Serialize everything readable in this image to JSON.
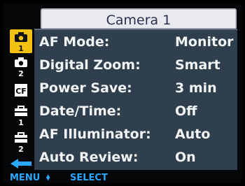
{
  "title": "Camera 1",
  "menu_items": [
    {
      "label": "AF Mode:",
      "value": "Monitor"
    },
    {
      "label": "Digital Zoom:",
      "value": "Smart"
    },
    {
      "label": "Power Save:",
      "value": "3 min"
    },
    {
      "label": "Date/Time:",
      "value": "Off"
    },
    {
      "label": "AF Illuminator:",
      "value": "Auto"
    },
    {
      "label": "Auto Review:",
      "value": "On"
    }
  ],
  "sidebar": {
    "tabs": [
      {
        "icon": "camera-icon",
        "num": "1",
        "active": true
      },
      {
        "icon": "camera-icon",
        "num": "2",
        "active": false
      },
      {
        "icon": "cf-card-icon",
        "num": "",
        "active": false
      },
      {
        "icon": "toolbox-icon",
        "num": "1",
        "active": false
      },
      {
        "icon": "toolbox-icon",
        "num": "2",
        "active": false
      }
    ]
  },
  "footer": {
    "menu_label": "MENU",
    "select_label": "SELECT"
  },
  "colors": {
    "panel": "#2f3f4d",
    "active_tab": "#f3c10f",
    "footer": "#2aa7ff"
  }
}
